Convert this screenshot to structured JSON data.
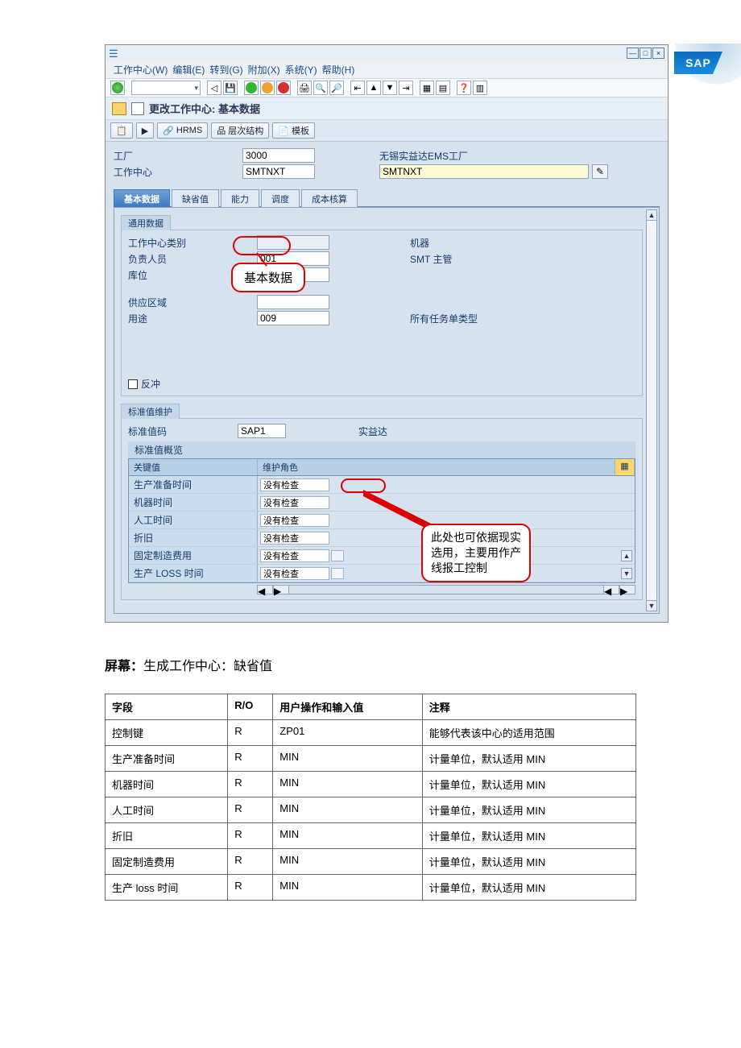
{
  "menubar": {
    "items": [
      "工作中心(W)",
      "编辑(E)",
      "转到(G)",
      "附加(X)",
      "系统(Y)",
      "帮助(H)"
    ]
  },
  "sap_logo": "SAP",
  "page_title": "更改工作中心: 基本数据",
  "toolbar2": {
    "hrms": "HRMS",
    "hier": "层次结构",
    "template": "模板"
  },
  "header": {
    "plant_label": "工厂",
    "plant_value": "3000",
    "plant_desc": "无锡实益达EMS工厂",
    "wc_label": "工作中心",
    "wc_value": "SMTNXT",
    "wc_input": "SMTNXT"
  },
  "tabs": [
    "基本数据",
    "缺省值",
    "能力",
    "调度",
    "成本核算"
  ],
  "section_general": {
    "title": "通用数据",
    "rows": {
      "cat_label": "工作中心类别",
      "cat_desc": "机器",
      "person_label": "负责人员",
      "person_value": "001",
      "person_desc": "SMT 主管",
      "loc_label": "库位",
      "supply_label": "供应区域",
      "usage_label": "用途",
      "usage_value": "009",
      "usage_desc": "所有任务单类型",
      "backflush_label": "反冲"
    }
  },
  "section_std": {
    "title": "标准值维护",
    "code_label": "标准值码",
    "code_value": "SAP1",
    "code_desc": "实益达",
    "overview_label": "标准值概览",
    "col_key": "关键值",
    "col_role": "维护角色",
    "rows": [
      {
        "key": "生产准备时间",
        "role": "没有检查"
      },
      {
        "key": "机器时间",
        "role": "没有检查"
      },
      {
        "key": "人工时间",
        "role": "没有检查"
      },
      {
        "key": "折旧",
        "role": "没有检查"
      },
      {
        "key": "固定制造费用",
        "role": "没有检查"
      },
      {
        "key": "生产 LOSS 时间",
        "role": "没有检查"
      }
    ]
  },
  "annotations": {
    "callout1": "基本数据",
    "callout2_l1": "此处也可依据现实",
    "callout2_l2": "选用，主要用作产",
    "callout2_l3": "线报工控制"
  },
  "below": {
    "heading_prefix": "屏幕：",
    "heading_rest": "生成工作中心：缺省值",
    "cols": [
      "字段",
      "R/O",
      "用户操作和输入值",
      "注释"
    ],
    "rows": [
      {
        "f": "控制键",
        "ro": "R",
        "op": "ZP01",
        "note": "能够代表该中心的适用范围"
      },
      {
        "f": "生产准备时间",
        "ro": "R",
        "op": "MIN",
        "note": "计量单位，默认适用 MIN"
      },
      {
        "f": "机器时间",
        "ro": "R",
        "op": "MIN",
        "note": "计量单位，默认适用 MIN"
      },
      {
        "f": "人工时间",
        "ro": "R",
        "op": "MIN",
        "note": "计量单位，默认适用 MIN"
      },
      {
        "f": "折旧",
        "ro": "R",
        "op": "MIN",
        "note": "计量单位，默认适用 MIN"
      },
      {
        "f": "固定制造费用",
        "ro": "R",
        "op": "MIN",
        "note": "计量单位，默认适用 MIN"
      },
      {
        "f": "生产 loss 时间",
        "ro": "R",
        "op": "MIN",
        "note": "计量单位，默认适用 MIN"
      }
    ]
  }
}
